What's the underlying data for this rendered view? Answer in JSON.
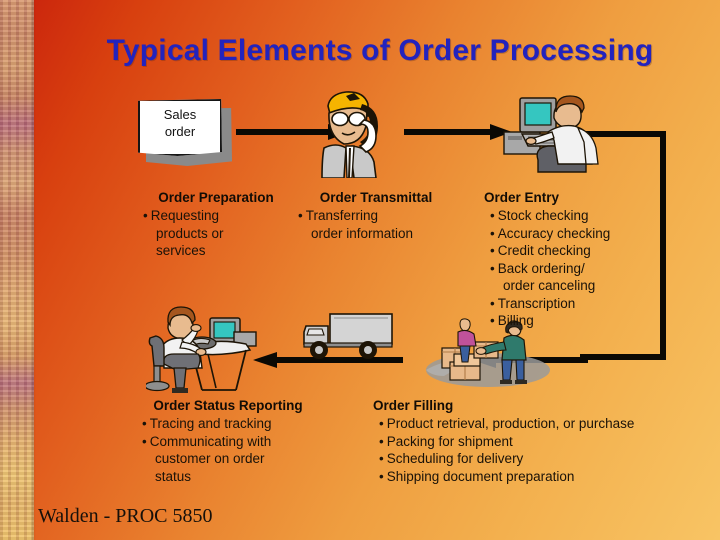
{
  "slide": {
    "title": "Typical Elements of Order Processing",
    "footer": "Walden - PROC 5850",
    "title_color": "#2323bd",
    "arrow_color": "#0b0904",
    "background_start": "#c81f0c",
    "background_end": "#f8c464"
  },
  "document": {
    "line1": "Sales",
    "line2": "order"
  },
  "stages": {
    "preparation": {
      "heading": "Order Preparation",
      "bullets": [
        {
          "text": "Requesting",
          "marker": "•",
          "continuation": false
        },
        {
          "text": "products or",
          "marker": "",
          "continuation": true
        },
        {
          "text": "services",
          "marker": "",
          "continuation": true
        }
      ]
    },
    "transmittal": {
      "heading": "Order Transmittal",
      "bullets": [
        {
          "text": "Transferring",
          "marker": "•",
          "continuation": false
        },
        {
          "text": "order information",
          "marker": "",
          "continuation": true
        }
      ]
    },
    "entry": {
      "heading": "Order Entry",
      "bullets": [
        {
          "text": "Stock checking",
          "marker": "•",
          "continuation": false
        },
        {
          "text": "Accuracy checking",
          "marker": "•",
          "continuation": false
        },
        {
          "text": "Credit checking",
          "marker": "•",
          "continuation": false
        },
        {
          "text": "Back ordering/",
          "marker": "•",
          "continuation": false
        },
        {
          "text": "order canceling",
          "marker": "",
          "continuation": true
        },
        {
          "text": "Transcription",
          "marker": "•",
          "continuation": false
        },
        {
          "text": "Billing",
          "marker": "•",
          "continuation": false
        }
      ]
    },
    "filling": {
      "heading": "Order Filling",
      "bullets": [
        {
          "text": "Product retrieval, production, or purchase",
          "marker": "•",
          "continuation": false
        },
        {
          "text": "Packing for shipment",
          "marker": "•",
          "continuation": false
        },
        {
          "text": "Scheduling for delivery",
          "marker": "•",
          "continuation": false
        },
        {
          "text": "Shipping document preparation",
          "marker": "•",
          "continuation": false
        }
      ]
    },
    "status_reporting": {
      "heading": "Order Status Reporting",
      "bullets": [
        {
          "text": "Tracing and tracking",
          "marker": "•",
          "continuation": false
        },
        {
          "text": "Communicating with",
          "marker": "•",
          "continuation": false
        },
        {
          "text": "customer on order",
          "marker": "",
          "continuation": true
        },
        {
          "text": "status",
          "marker": "",
          "continuation": true
        }
      ]
    }
  },
  "illustrations": [
    {
      "name": "sales-order-document",
      "caption": "Sales order"
    },
    {
      "name": "person-on-phone",
      "caption": "Order transmittal clerk on telephone"
    },
    {
      "name": "person-at-computer",
      "caption": "Order entry operator at desktop computer"
    },
    {
      "name": "warehouse-workers-boxes",
      "caption": "Workers handling cartons in warehouse"
    },
    {
      "name": "delivery-truck",
      "caption": "Delivery box truck"
    },
    {
      "name": "person-at-desk-phone",
      "caption": "Status reporting agent at desk with phone"
    }
  ]
}
